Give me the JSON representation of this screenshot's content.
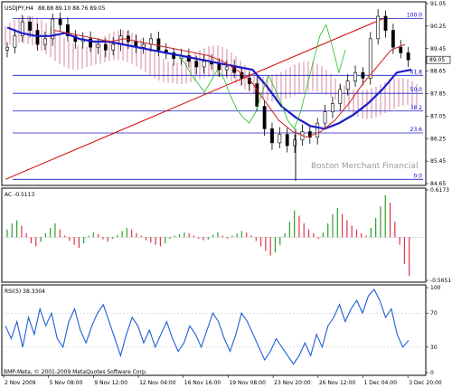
{
  "chart_data": [
    {
      "type": "candlestick",
      "title": "USDJPY,H4",
      "ohlc_readout": "88.88 89.10 88.76 89.05",
      "ylim": [
        84.65,
        91.05
      ],
      "y_ticks": [
        "91.05",
        "90.25",
        "89.45",
        "88.65",
        "87.85",
        "87.05",
        "86.25",
        "85.45",
        "84.65"
      ],
      "current_price": "89.05",
      "watermark": "Boston Merchant Financial",
      "fibonacci_levels": [
        {
          "label": "100.0",
          "price": 90.52
        },
        {
          "label": "61.8",
          "price": 88.5
        },
        {
          "label": "50.0",
          "price": 87.86
        },
        {
          "label": "38.2",
          "price": 87.23
        },
        {
          "label": "23.6",
          "price": 86.45
        },
        {
          "label": "0.0",
          "price": 84.8
        }
      ],
      "close_prices": [
        89.5,
        89.9,
        90.4,
        90.1,
        89.6,
        89.8,
        90.5,
        90.3,
        89.9,
        89.7,
        89.8,
        89.5,
        89.6,
        89.4,
        89.6,
        89.9,
        89.7,
        89.5,
        89.6,
        89.8,
        89.4,
        89.3,
        89.1,
        89.2,
        89.0,
        88.8,
        89.0,
        88.9,
        88.7,
        88.8,
        88.6,
        88.4,
        88.2,
        87.4,
        86.6,
        86.1,
        86.4,
        86.0,
        86.2,
        86.5,
        86.3,
        86.8,
        87.2,
        87.5,
        88.0,
        88.3,
        88.6,
        88.4,
        89.8,
        90.6,
        90.1,
        89.5,
        89.3,
        89.05
      ],
      "series": [
        {
          "values": [
            90.2,
            90.0,
            89.9,
            89.9,
            90.0,
            89.8,
            89.7,
            89.7,
            89.6,
            89.5,
            89.4,
            89.3,
            89.2,
            89.1,
            89.0,
            88.9,
            88.8,
            88.7,
            88.1,
            87.4,
            87.0,
            86.7,
            86.6,
            86.8,
            87.1,
            87.5,
            88.0,
            88.6,
            88.7
          ]
        },
        {
          "values": [
            90.1,
            90.0,
            89.9,
            89.8,
            89.7,
            89.8,
            89.7,
            89.6,
            89.5,
            89.4,
            89.3,
            89.2,
            89.0,
            88.7,
            88.3,
            87.6,
            86.9,
            86.5,
            86.3,
            86.5,
            86.9,
            87.5,
            88.2,
            88.8,
            89.4,
            89.6
          ]
        }
      ],
      "trendline": {
        "from": 84.8,
        "to": 90.52
      }
    },
    {
      "type": "bar",
      "title": "AC -0.5113",
      "y_ticks": [
        "0.6173",
        "-0.5651"
      ],
      "ylim": [
        -0.5651,
        0.6173
      ],
      "values": [
        0.1,
        0.18,
        0.22,
        0.15,
        0.05,
        -0.08,
        -0.12,
        -0.06,
        0.05,
        0.12,
        0.18,
        0.1,
        0.02,
        -0.05,
        -0.1,
        -0.14,
        -0.08,
        0.02,
        0.06,
        0.04,
        -0.03,
        -0.06,
        -0.02,
        0.03,
        0.08,
        0.12,
        0.1,
        0.05,
        0.02,
        -0.04,
        -0.07,
        -0.1,
        -0.12,
        -0.08,
        -0.02,
        0.02,
        0.04,
        0.06,
        0.05,
        0.02,
        -0.02,
        -0.04,
        -0.03,
        0.03,
        0.06,
        0.02,
        -0.02,
        0.02,
        0.05,
        0.08,
        0.06,
        0.02,
        -0.05,
        -0.12,
        -0.18,
        -0.24,
        -0.2,
        -0.1,
        0.05,
        0.2,
        0.35,
        0.28,
        0.18,
        0.1,
        0.05,
        -0.02,
        0.06,
        0.18,
        0.3,
        0.38,
        0.3,
        0.22,
        0.15,
        0.1,
        0.05,
        0.02,
        0.12,
        0.25,
        0.4,
        0.55,
        0.45,
        0.2,
        -0.1,
        -0.35,
        -0.51
      ]
    },
    {
      "type": "line",
      "title": "RSI(5) 38.3304",
      "y_ticks": [
        "100",
        "70",
        "30",
        "0"
      ],
      "ylim": [
        0,
        100
      ],
      "x_ticks": [
        "2 Nov 2009",
        "5 Nov 08:00",
        "9 Nov 12:00",
        "12 Nov 04:00",
        "16 Nov 16:00",
        "19 Nov 08:00",
        "23 Nov 20:00",
        "26 Nov 12:00",
        "1 Dec 04:00",
        "3 Dec 20:00"
      ],
      "copyright": "BMP-Meta, © 2001-2009 MetaQuotes Software Corp.",
      "values": [
        55,
        40,
        60,
        30,
        65,
        45,
        75,
        55,
        70,
        40,
        30,
        60,
        75,
        50,
        35,
        55,
        70,
        80,
        60,
        40,
        20,
        45,
        65,
        55,
        35,
        50,
        30,
        45,
        60,
        40,
        25,
        35,
        55,
        45,
        30,
        50,
        70,
        60,
        40,
        25,
        45,
        70,
        60,
        45,
        30,
        15,
        25,
        40,
        30,
        20,
        10,
        20,
        35,
        20,
        45,
        30,
        55,
        65,
        80,
        60,
        75,
        85,
        70,
        90,
        98,
        85,
        65,
        75,
        45,
        30,
        38
      ]
    }
  ]
}
